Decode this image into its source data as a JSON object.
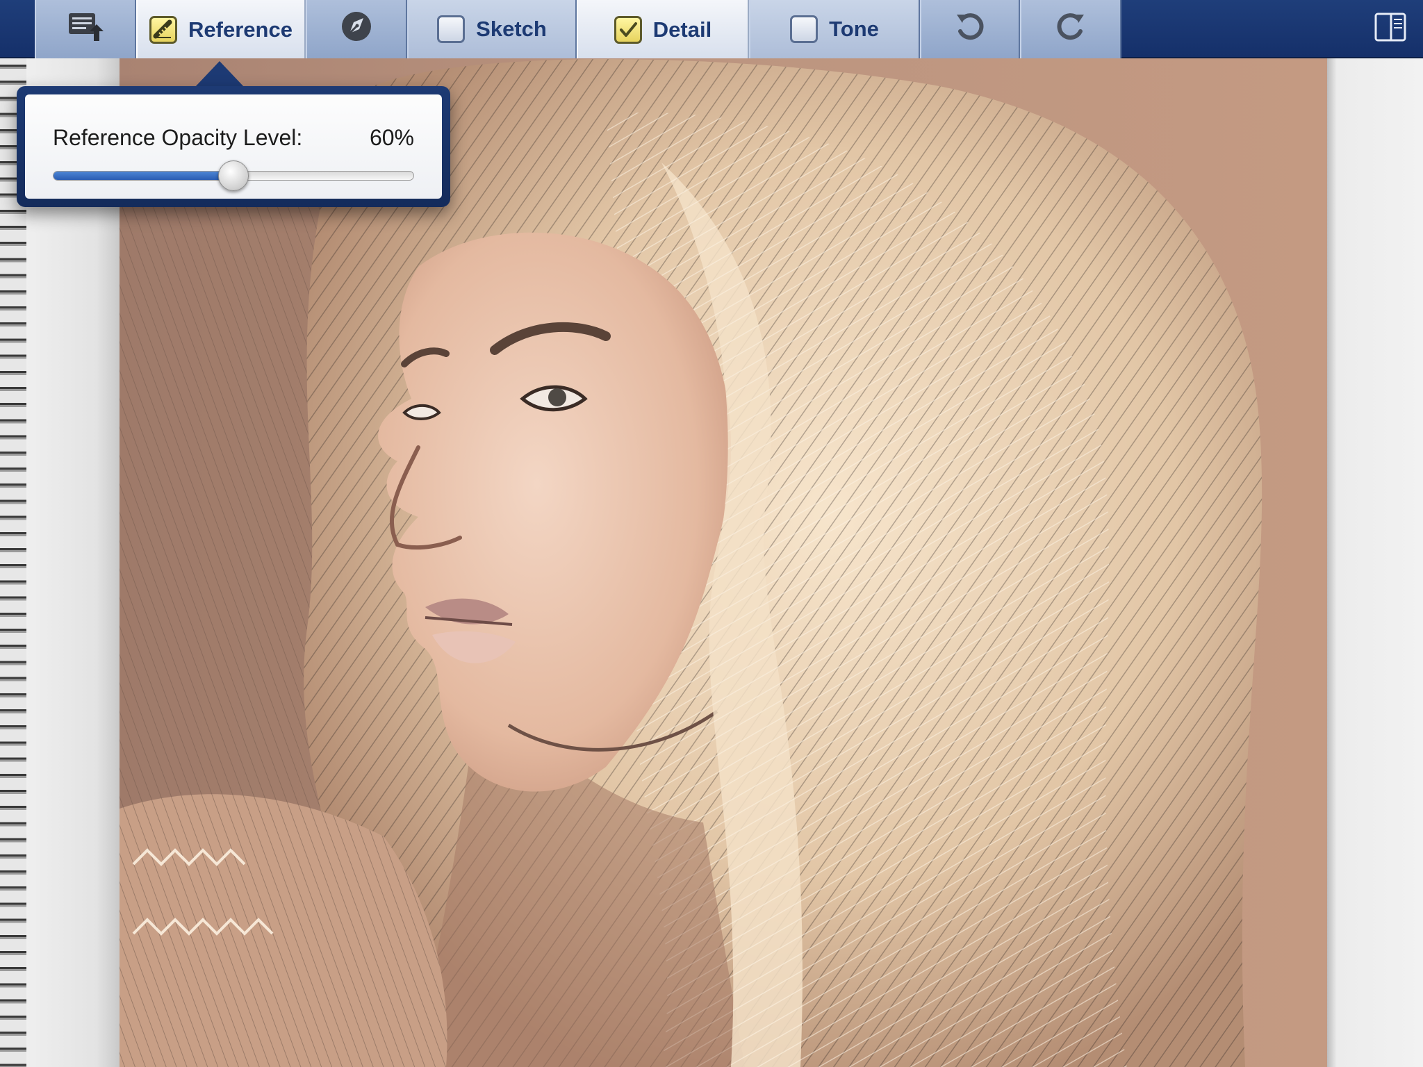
{
  "toolbar": {
    "tabs": [
      {
        "id": "gallery",
        "icon": "gallery-export-icon"
      },
      {
        "id": "reference",
        "label": "Reference",
        "checked": true,
        "icon": "ruler-icon"
      },
      {
        "id": "tools",
        "icon": "pen-nib-icon"
      },
      {
        "id": "sketch",
        "label": "Sketch",
        "checked": false
      },
      {
        "id": "detail",
        "label": "Detail",
        "checked": true
      },
      {
        "id": "tone",
        "label": "Tone",
        "checked": false
      },
      {
        "id": "undo",
        "icon": "undo-icon"
      },
      {
        "id": "redo",
        "icon": "redo-icon"
      },
      {
        "id": "panel",
        "icon": "split-view-icon"
      }
    ],
    "active_tab": "detail"
  },
  "popover": {
    "label": "Reference Opacity Level:",
    "value_text": "60%",
    "slider_fraction": 0.5
  },
  "colors": {
    "toolbar_bg": "#1a3670",
    "tab_text": "#1d3a73",
    "slider_fill": "#3a70c4",
    "canvas_bg": "#b48b73"
  }
}
